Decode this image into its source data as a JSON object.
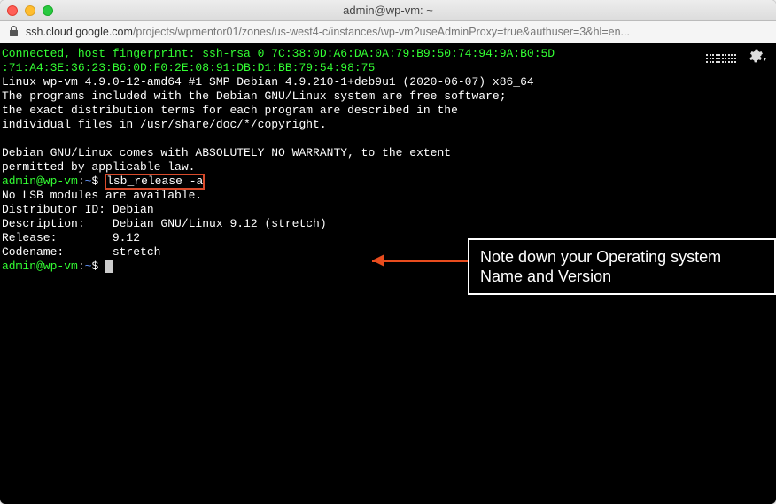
{
  "window": {
    "title": "admin@wp-vm: ~"
  },
  "address": {
    "host": "ssh.cloud.google.com",
    "path": "/projects/wpmentor01/zones/us-west4-c/instances/wp-vm?useAdminProxy=true&authuser=3&hl=en..."
  },
  "terminal": {
    "connected_line1": "Connected, host fingerprint: ssh-rsa 0 7C:38:0D:A6:DA:0A:79:B9:50:74:94:9A:B0:5D",
    "connected_line2": ":71:A4:3E:36:23:B6:0D:F0:2E:08:91:DB:D1:BB:79:54:98:75",
    "kernel": "Linux wp-vm 4.9.0-12-amd64 #1 SMP Debian 4.9.210-1+deb9u1 (2020-06-07) x86_64",
    "blank": "",
    "motd1": "The programs included with the Debian GNU/Linux system are free software;",
    "motd2": "the exact distribution terms for each program are described in the",
    "motd3": "individual files in /usr/share/doc/*/copyright.",
    "motd4": "Debian GNU/Linux comes with ABSOLUTELY NO WARRANTY, to the extent",
    "motd5": "permitted by applicable law.",
    "prompt_user": "admin@wp-vm",
    "prompt_path": "~",
    "prompt_symbol": "$",
    "command": "lsb_release -a",
    "out1": "No LSB modules are available.",
    "out2": "Distributor ID: Debian",
    "out3": "Description:    Debian GNU/Linux 9.12 (stretch)",
    "out4": "Release:        9.12",
    "out5": "Codename:       stretch"
  },
  "callout": {
    "text": "Note down your Operating system Name and Version"
  }
}
